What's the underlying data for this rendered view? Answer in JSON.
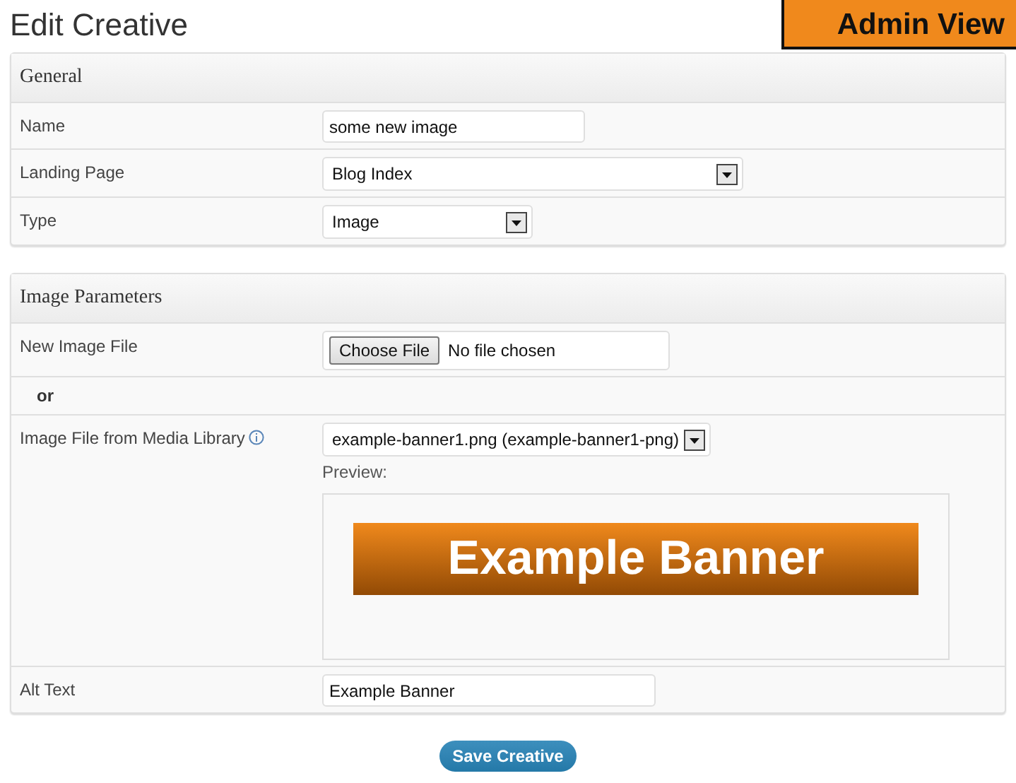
{
  "title": "Edit Creative",
  "badge": "Admin View",
  "sections": [
    {
      "heading": "General",
      "rows": [
        {
          "kind": "text",
          "label": "Name",
          "value": "some new image"
        },
        {
          "kind": "select",
          "label": "Landing Page",
          "value": "Blog Index"
        },
        {
          "kind": "select",
          "label": "Type",
          "value": "Image"
        }
      ]
    },
    {
      "heading": "Image Parameters",
      "rows": [
        {
          "kind": "file",
          "label": "New Image File",
          "button": "Choose File",
          "status": "No file chosen"
        },
        {
          "kind": "separator",
          "label": "or"
        },
        {
          "kind": "media",
          "label": "Image File from Media Library",
          "info": true,
          "value": "example-banner1.png (example-banner1-png)",
          "preview_label": "Preview:",
          "banner": "Example Banner"
        },
        {
          "kind": "text",
          "label": "Alt Text",
          "value": "Example Banner"
        }
      ]
    }
  ],
  "save_button": "Save Creative"
}
